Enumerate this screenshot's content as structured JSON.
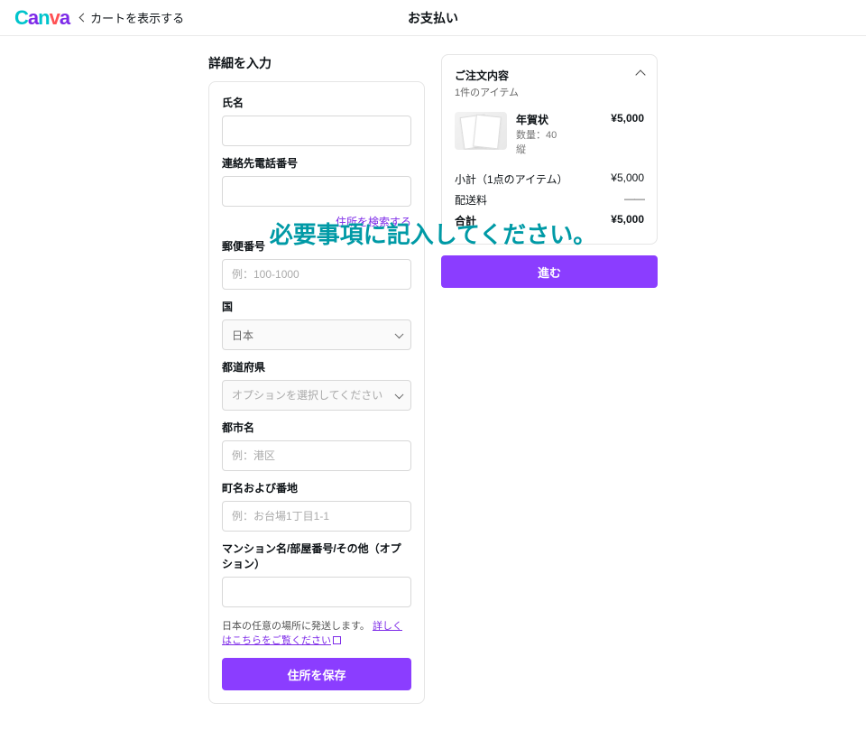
{
  "brand": "Canva",
  "header": {
    "back_label": "カートを表示する",
    "title": "お支払い"
  },
  "form": {
    "heading": "詳細を入力",
    "name_label": "氏名",
    "phone_label": "連絡先電話番号",
    "search_address": "住所を検索する",
    "postal_label": "郵便番号",
    "postal_placeholder": "例：100-1000",
    "country_label": "国",
    "country_value": "日本",
    "prefecture_label": "都道府県",
    "prefecture_placeholder": "オプションを選択してください",
    "city_label": "都市名",
    "city_placeholder": "例：港区",
    "street_label": "町名および番地",
    "street_placeholder": "例：お台場1丁目1-1",
    "extra_label": "マンション名/部屋番号/その他（オプション）",
    "helper_prefix": "日本の任意の場所に発送します。",
    "helper_link": "詳しくはこちらをご覧ください",
    "save_button": "住所を保存"
  },
  "order": {
    "heading": "ご注文内容",
    "count_label": "1件のアイテム",
    "item": {
      "title": "年賀状",
      "qty": "数量：40",
      "orient": "縦",
      "price": "¥5,000"
    },
    "subtotal_label": "小計（1点のアイテム）",
    "subtotal_value": "¥5,000",
    "shipping_label": "配送料",
    "shipping_value": "――",
    "total_label": "合計",
    "total_value": "¥5,000",
    "cta": "進む"
  },
  "overlay_text": "必要事項に記入してください。"
}
